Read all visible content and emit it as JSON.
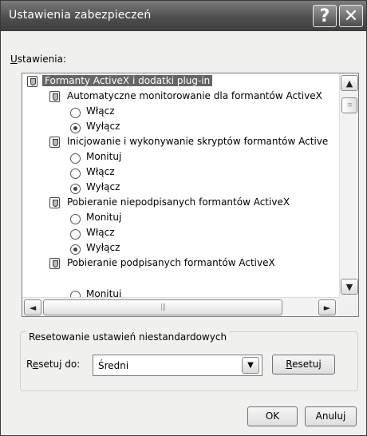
{
  "window": {
    "title": "Ustawienia zabezpieczeń",
    "help_glyph": "?",
    "close_glyph": "✕"
  },
  "settings_label": {
    "accel": "U",
    "rest": "stawienia:"
  },
  "tree": {
    "category": "Formanty ActiveX i dodatki plug-in",
    "items": [
      {
        "label": "Automatyczne monitorowanie dla formantów ActiveX",
        "options": [
          {
            "label": "Włącz",
            "selected": false
          },
          {
            "label": "Wyłącz",
            "selected": true
          }
        ]
      },
      {
        "label": "Inicjowanie i wykonywanie skryptów formantów Active",
        "options": [
          {
            "label": "Monituj",
            "selected": false
          },
          {
            "label": "Włącz",
            "selected": false
          },
          {
            "label": "Wyłącz",
            "selected": true
          }
        ]
      },
      {
        "label": "Pobieranie niepodpisanych formantów ActiveX",
        "options": [
          {
            "label": "Monituj",
            "selected": false
          },
          {
            "label": "Włącz",
            "selected": false
          },
          {
            "label": "Wyłącz",
            "selected": true
          }
        ]
      },
      {
        "label": "Pobieranie podpisanych formantów ActiveX",
        "options": [
          {
            "label": "Monituj",
            "selected": false
          }
        ]
      }
    ]
  },
  "scroll": {
    "up": "▲",
    "down": "▼",
    "left": "◄",
    "right": "►",
    "grip_h": "|||",
    "grip_v": "≡"
  },
  "reset_group": {
    "legend": "Resetowanie ustawień niestandardowych",
    "reset_label_pre": "R",
    "reset_label_accel": "e",
    "reset_label_post": "setuj do:",
    "selected": "Średni",
    "arrow": "▼",
    "reset_button_accel": "R",
    "reset_button_rest": "esetuj"
  },
  "buttons": {
    "ok": "OK",
    "cancel": "Anuluj"
  }
}
